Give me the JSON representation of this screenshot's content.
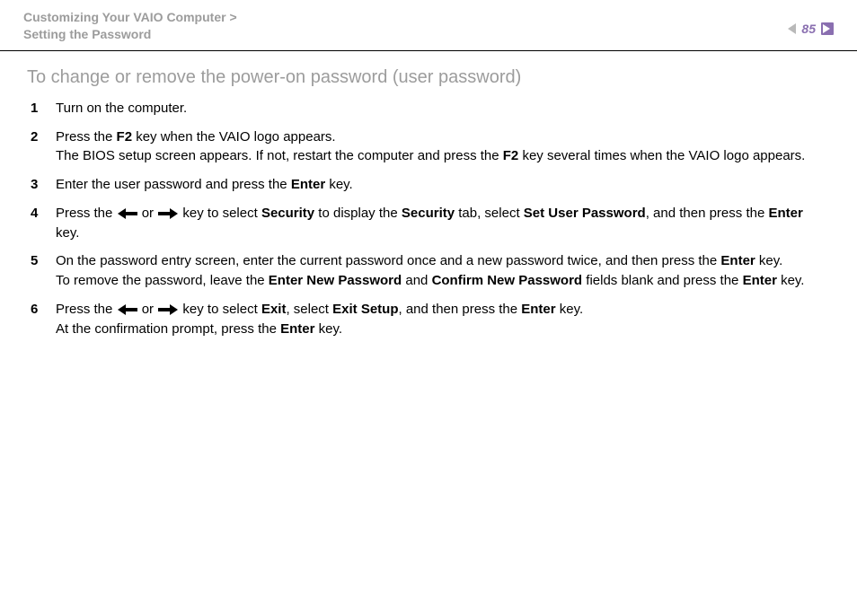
{
  "header": {
    "breadcrumb_line1": "Customizing Your VAIO Computer",
    "breadcrumb_sep": ">",
    "breadcrumb_line2": "Setting the Password",
    "page_number": "85"
  },
  "title": "To change or remove the power-on password (user password)",
  "steps": [
    {
      "num": "1",
      "segments": [
        {
          "t": "Turn on the computer."
        }
      ]
    },
    {
      "num": "2",
      "segments": [
        {
          "t": "Press the "
        },
        {
          "t": "F2",
          "b": true
        },
        {
          "t": " key when the VAIO logo appears."
        },
        {
          "br": true
        },
        {
          "t": "The BIOS setup screen appears. If not, restart the computer and press the "
        },
        {
          "t": "F2",
          "b": true
        },
        {
          "t": " key several times when the VAIO logo appears."
        }
      ]
    },
    {
      "num": "3",
      "segments": [
        {
          "t": "Enter the user password and press the "
        },
        {
          "t": "Enter",
          "b": true
        },
        {
          "t": " key."
        }
      ]
    },
    {
      "num": "4",
      "segments": [
        {
          "t": "Press the "
        },
        {
          "arrow": "left"
        },
        {
          "t": " or "
        },
        {
          "arrow": "right"
        },
        {
          "t": " key to select "
        },
        {
          "t": "Security",
          "b": true
        },
        {
          "t": " to display the "
        },
        {
          "t": "Security",
          "b": true
        },
        {
          "t": " tab, select "
        },
        {
          "t": "Set User Password",
          "b": true
        },
        {
          "t": ", and then press the "
        },
        {
          "t": "Enter",
          "b": true
        },
        {
          "t": " key."
        }
      ]
    },
    {
      "num": "5",
      "segments": [
        {
          "t": "On the password entry screen, enter the current password once and a new password twice, and then press the "
        },
        {
          "t": "Enter",
          "b": true
        },
        {
          "t": " key."
        },
        {
          "br": true
        },
        {
          "t": "To remove the password, leave the "
        },
        {
          "t": "Enter New Password",
          "b": true
        },
        {
          "t": " and "
        },
        {
          "t": "Confirm New Password",
          "b": true
        },
        {
          "t": " fields blank and press the "
        },
        {
          "t": "Enter",
          "b": true
        },
        {
          "t": " key."
        }
      ]
    },
    {
      "num": "6",
      "segments": [
        {
          "t": "Press the "
        },
        {
          "arrow": "left"
        },
        {
          "t": " or "
        },
        {
          "arrow": "right"
        },
        {
          "t": " key to select "
        },
        {
          "t": "Exit",
          "b": true
        },
        {
          "t": ", select "
        },
        {
          "t": "Exit Setup",
          "b": true
        },
        {
          "t": ", and then press the "
        },
        {
          "t": "Enter",
          "b": true
        },
        {
          "t": " key."
        },
        {
          "br": true
        },
        {
          "t": "At the confirmation prompt, press the "
        },
        {
          "t": "Enter",
          "b": true
        },
        {
          "t": " key."
        }
      ]
    }
  ]
}
